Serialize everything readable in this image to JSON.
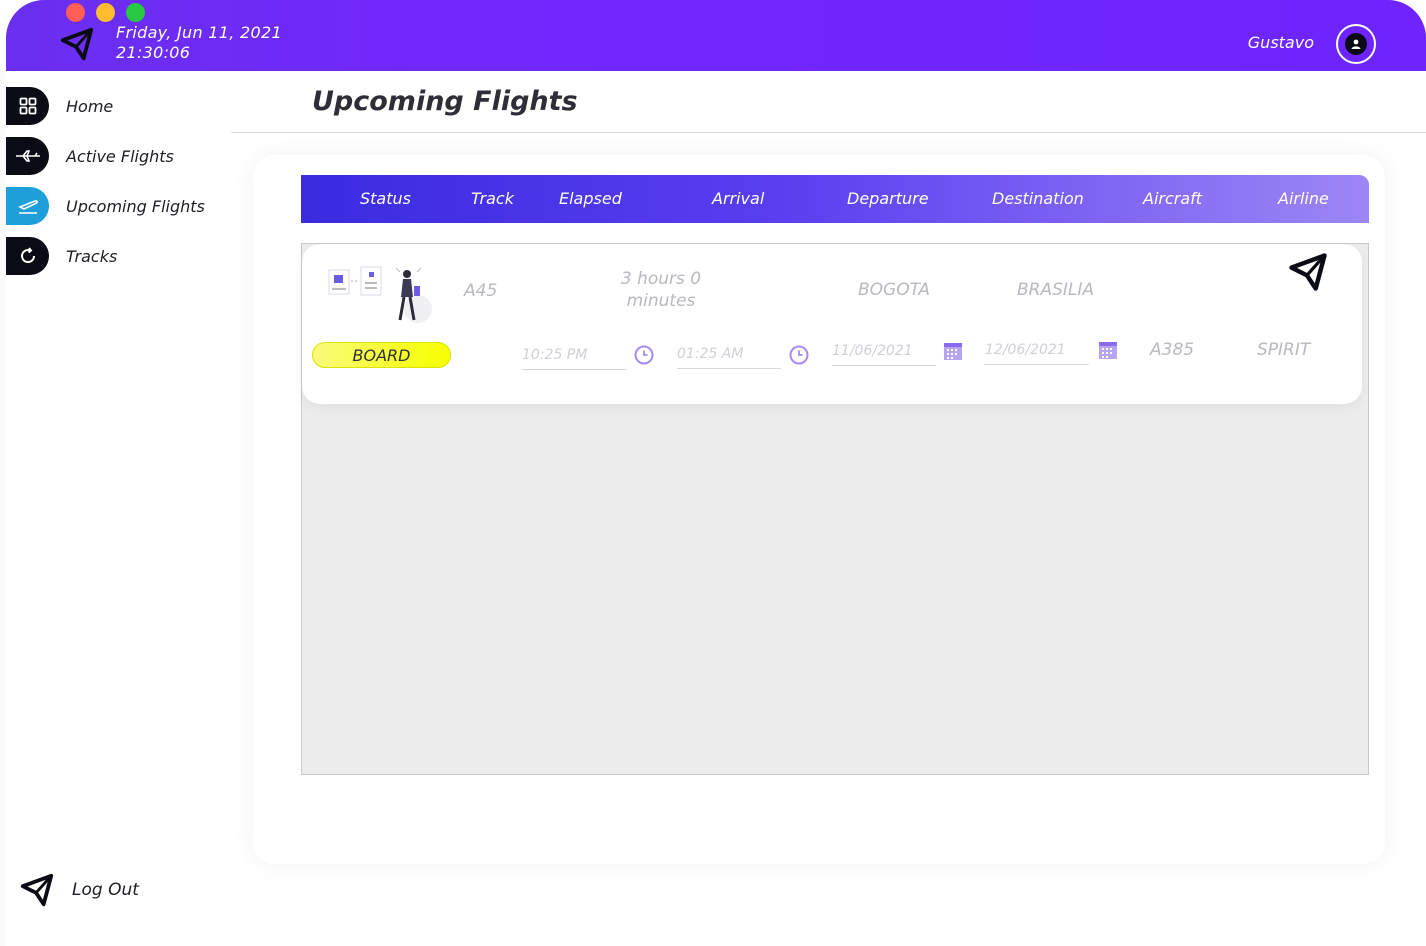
{
  "header": {
    "date": "Friday, Jun 11, 2021",
    "time": "21:30:06",
    "user_name": "Gustavo"
  },
  "sidebar": {
    "items": [
      {
        "label": "Home",
        "icon": "grid-icon"
      },
      {
        "label": "Active Flights",
        "icon": "plane-icon"
      },
      {
        "label": "Upcoming Flights",
        "icon": "plane-takeoff-icon",
        "active": true
      },
      {
        "label": "Tracks",
        "icon": "refresh-icon"
      }
    ],
    "logout_label": "Log Out"
  },
  "page": {
    "title": "Upcoming Flights"
  },
  "table": {
    "columns": [
      "Status",
      "Track",
      "Elapsed",
      "Arrival",
      "Departure",
      "Destination",
      "Aircraft",
      "Airline"
    ],
    "rows": [
      {
        "status": "BOARD",
        "track": "A45",
        "elapsed": "3 hours 0 minutes",
        "origin": "BOGOTA",
        "destination": "BRASILIA",
        "arrival_time": "10:25 PM",
        "departure_time": "01:25 AM",
        "arrival_date": "11/06/2021",
        "departure_date": "12/06/2021",
        "aircraft": "A385",
        "airline": "SPIRIT"
      }
    ]
  },
  "colors": {
    "header": "#6d24ff",
    "active_nav": "#1e9fd9",
    "status_board": "#f6ff2c",
    "accent": "#8a6cf0"
  }
}
